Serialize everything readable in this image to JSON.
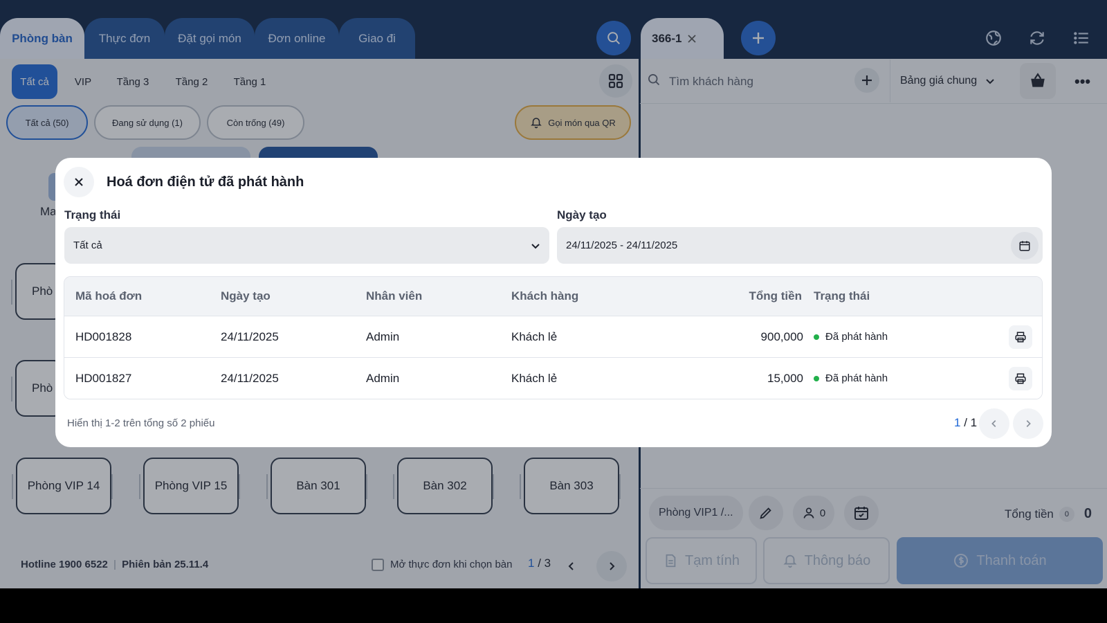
{
  "top_tabs": [
    "Phòng bàn",
    "Thực đơn",
    "Đặt gọi món",
    "Đơn online",
    "Giao đi"
  ],
  "order_tab": {
    "label": "366-1"
  },
  "floor_tabs": [
    "Tất cả",
    "VIP",
    "Tầng 3",
    "Tầng 2",
    "Tầng 1"
  ],
  "filter_pills": [
    "Tất cả (50)",
    "Đang sử dụng (1)",
    "Còn trống (49)"
  ],
  "qr_button": "Gọi món qua QR",
  "partial_labels": {
    "ma": "Ma",
    "phong_a": "Phò",
    "phong_b": "Phò"
  },
  "rooms": [
    "Phòng VIP 14",
    "Phòng VIP 15",
    "Bàn 301",
    "Bàn 302",
    "Bàn 303"
  ],
  "footer": {
    "hotline": "Hotline 1900 6522",
    "version": "Phiên bản 25.11.4",
    "open_menu_label": "Mở thực đơn khi chọn bàn",
    "page_current": "1",
    "page_sep": " / ",
    "page_total": "3"
  },
  "right_panel": {
    "search_placeholder": "Tìm khách hàng",
    "price_list": "Bảng giá chung",
    "table_chip": "Phòng VIP1 /...",
    "guests": "0",
    "total_label": "Tổng tiền",
    "total_count": "0",
    "total_value": "0",
    "btn_temp": "Tạm tính",
    "btn_notify": "Thông báo",
    "btn_pay": "Thanh toán"
  },
  "modal": {
    "title": "Hoá đơn điện tử đã phát hành",
    "status_label": "Trạng thái",
    "status_value": "Tất cả",
    "date_label": "Ngày tạo",
    "date_value": "24/11/2025 - 24/11/2025",
    "columns": [
      "Mã hoá đơn",
      "Ngày tạo",
      "Nhân viên",
      "Khách hàng",
      "Tổng tiền",
      "Trạng thái"
    ],
    "rows": [
      [
        "HD001828",
        "24/11/2025",
        "Admin",
        "Khách lẻ",
        "900,000",
        "Đã phát hành"
      ],
      [
        "HD001827",
        "24/11/2025",
        "Admin",
        "Khách lẻ",
        "15,000",
        "Đã phát hành"
      ]
    ],
    "summary": "Hiển thị 1-2 trên tổng số 2 phiếu",
    "page_current": "1",
    "page_sep": " / ",
    "page_total": "1"
  },
  "colors": {
    "navy": "#0c2244",
    "primary": "#1d66d6",
    "success": "#22b04b"
  }
}
